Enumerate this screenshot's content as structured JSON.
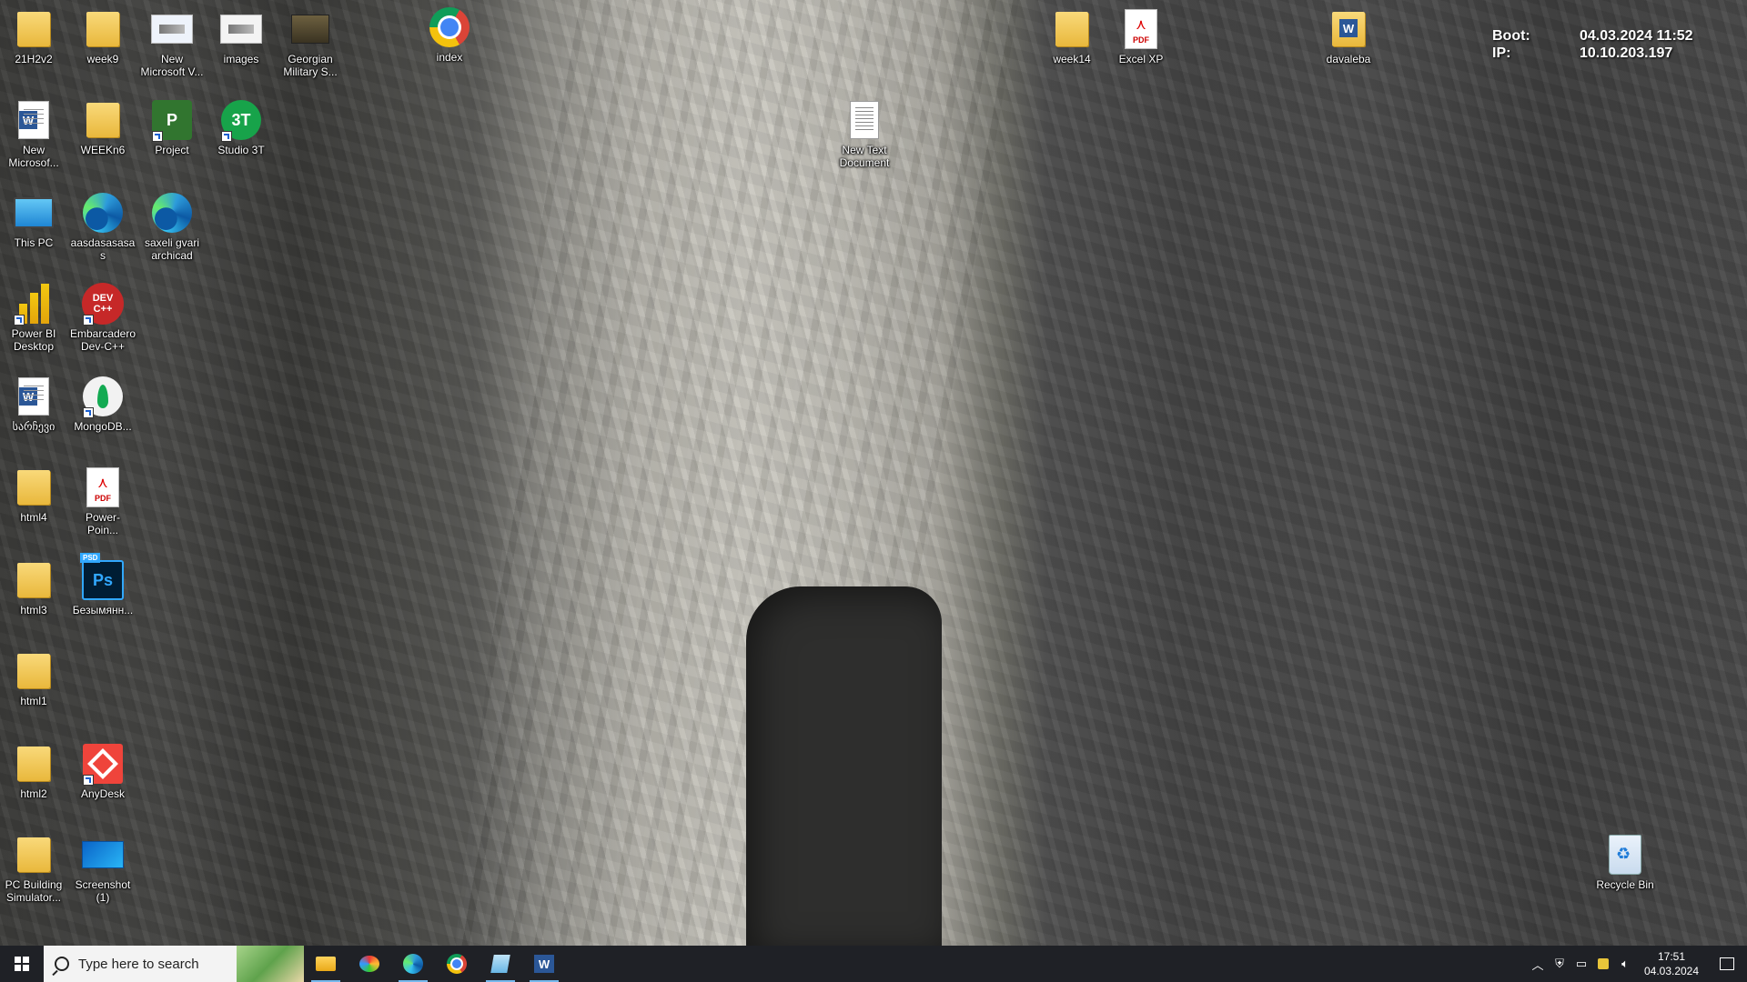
{
  "desktop": {
    "icons": [
      {
        "label": "21H2v2",
        "icon": "folder-icon"
      },
      {
        "label": "week9",
        "icon": "chrome-html-icon"
      },
      {
        "label": "New Microsoft V...",
        "icon": "visio-doc-icon"
      },
      {
        "label": "images",
        "icon": "image-file-icon"
      },
      {
        "label": "Georgian Military S...",
        "icon": "game-shortcut-icon"
      },
      {
        "label": "index",
        "icon": "chrome-icon"
      },
      {
        "label": "week14",
        "icon": "chrome-html-icon"
      },
      {
        "label": "Excel XP",
        "icon": "pdf-icon"
      },
      {
        "label": "davaleba",
        "icon": "word-doc-icon"
      },
      {
        "label": "New Microsof...",
        "icon": "word-icon"
      },
      {
        "label": "WEEKn6",
        "icon": "chrome-html-icon"
      },
      {
        "label": "Project",
        "icon": "project-icon"
      },
      {
        "label": "Studio 3T",
        "icon": "studio3t-icon"
      },
      {
        "label": "New Text Document",
        "icon": "text-file-icon"
      },
      {
        "label": "This PC",
        "icon": "this-pc-icon"
      },
      {
        "label": "aasdasasasas",
        "icon": "edge-icon"
      },
      {
        "label": "saxeli gvari archicad",
        "icon": "edge-icon"
      },
      {
        "label": "Power BI Desktop",
        "icon": "powerbi-icon"
      },
      {
        "label": "Embarcadero Dev-C++",
        "icon": "devcpp-icon"
      },
      {
        "label": "სარჩევი",
        "icon": "word-doc-icon"
      },
      {
        "label": "MongoDB...",
        "icon": "mongodb-icon"
      },
      {
        "label": "html4",
        "icon": "chrome-html-icon"
      },
      {
        "label": "Power-Poin...",
        "icon": "pdf-icon"
      },
      {
        "label": "html3",
        "icon": "folder-icon"
      },
      {
        "label": "Безымянн...",
        "icon": "photoshop-icon"
      },
      {
        "label": "html1",
        "icon": "folder-icon"
      },
      {
        "label": "html2",
        "icon": "folder-icon"
      },
      {
        "label": "AnyDesk",
        "icon": "anydesk-icon"
      },
      {
        "label": "PC Building Simulator...",
        "icon": "folder-icon"
      },
      {
        "label": "Screenshot (1)",
        "icon": "screenshot-icon"
      },
      {
        "label": "Recycle Bin",
        "icon": "recycle-bin-icon"
      }
    ]
  },
  "bginfo": {
    "boot_label": "Boot:",
    "boot_value": "04.03.2024 11:52",
    "ip_label": "IP:",
    "ip_value": "10.10.203.197"
  },
  "taskbar": {
    "search_placeholder": "Type here to search",
    "apps": [
      "File Explorer",
      "Paint",
      "Microsoft Edge",
      "Google Chrome",
      "Notes",
      "Microsoft Word"
    ],
    "time": "17:51",
    "date": "04.03.2024"
  }
}
